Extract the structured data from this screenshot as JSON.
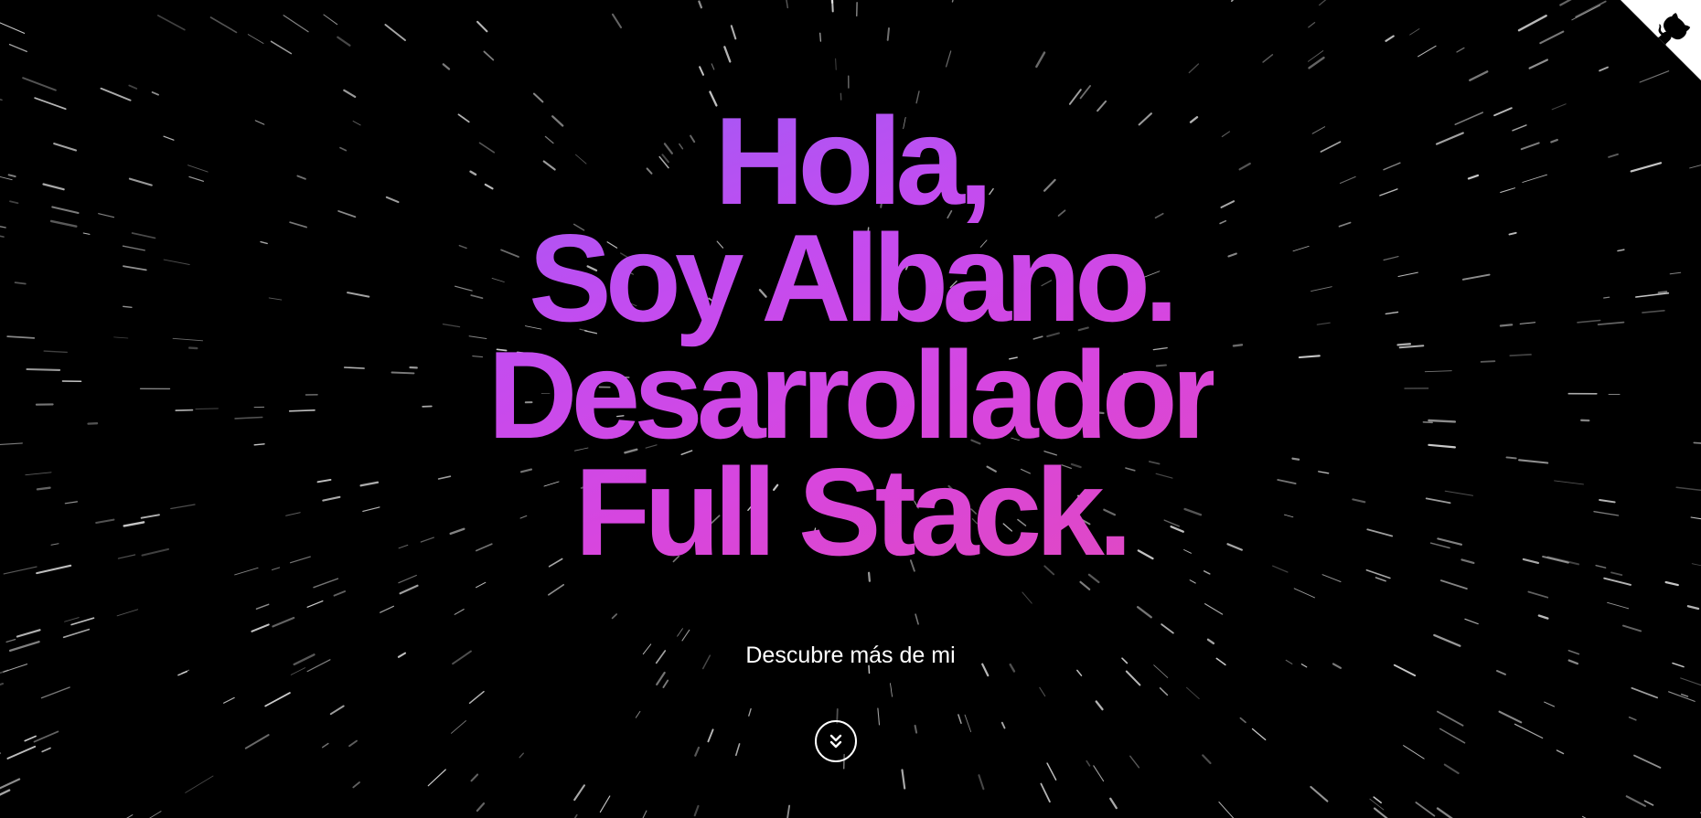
{
  "hero": {
    "line1": "Hola,",
    "line2": "Soy Albano.",
    "line3": "Desarrollador",
    "line4": "Full Stack."
  },
  "cta": {
    "text": "Descubre más de mi",
    "scroll_icon": "chevrons-down-icon"
  },
  "github_corner": {
    "icon": "github-octocat-icon"
  },
  "colors": {
    "background": "#000000",
    "gradient_start": "#9c5cf6",
    "gradient_mid": "#d746df",
    "gradient_end": "#e148c0",
    "text": "#ffffff"
  }
}
